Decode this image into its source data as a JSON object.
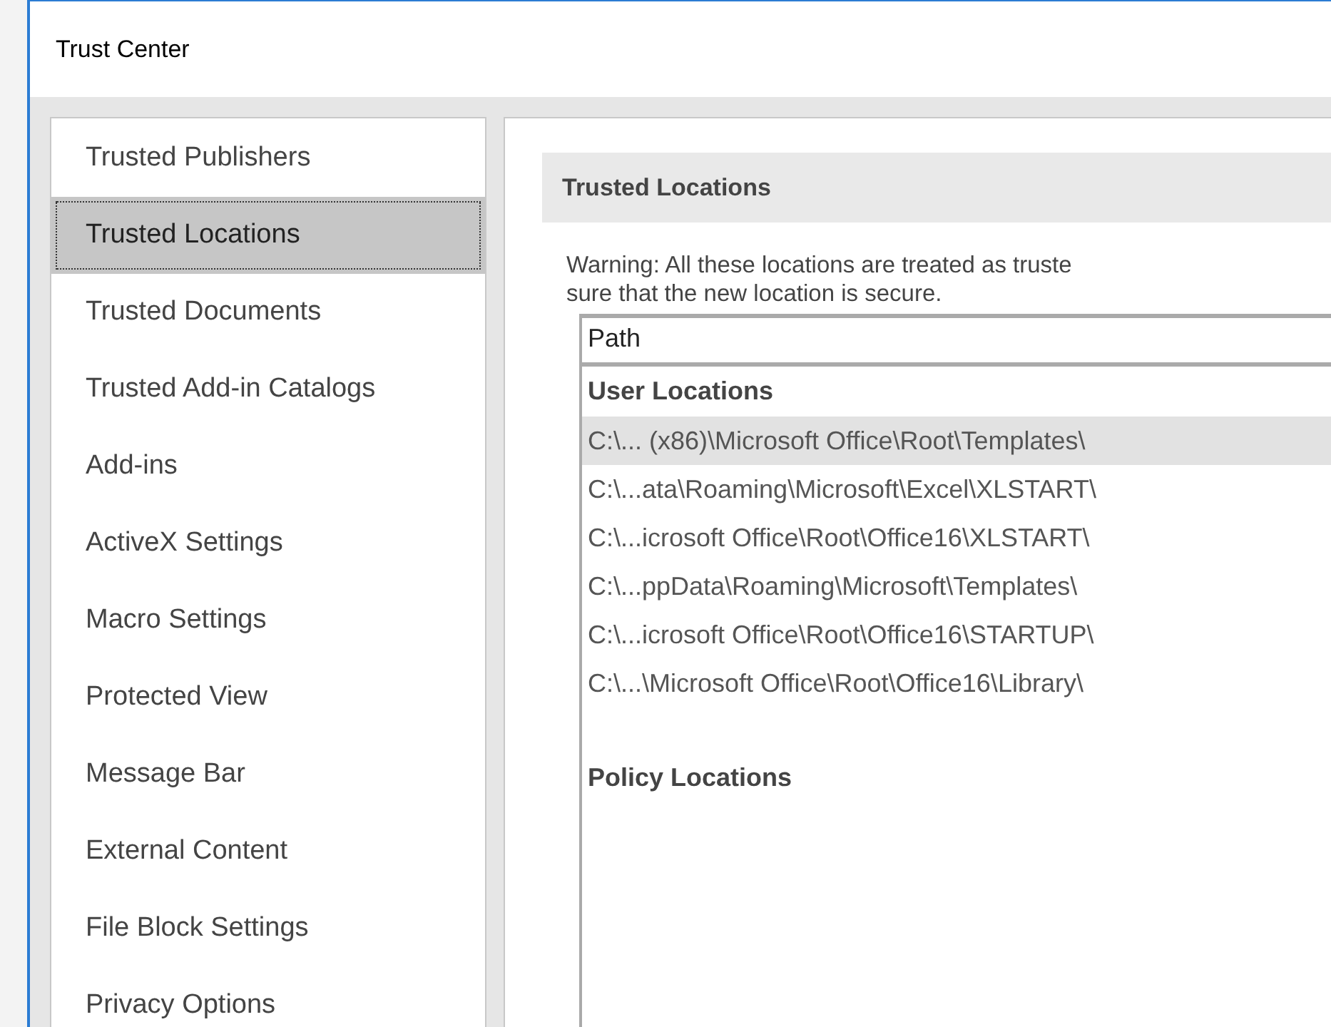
{
  "window": {
    "title": "Trust Center"
  },
  "sidebar": {
    "items": [
      {
        "label": "Trusted Publishers",
        "selected": false
      },
      {
        "label": "Trusted Locations",
        "selected": true
      },
      {
        "label": "Trusted Documents",
        "selected": false
      },
      {
        "label": "Trusted Add-in Catalogs",
        "selected": false
      },
      {
        "label": "Add-ins",
        "selected": false
      },
      {
        "label": "ActiveX Settings",
        "selected": false
      },
      {
        "label": "Macro Settings",
        "selected": false
      },
      {
        "label": "Protected View",
        "selected": false
      },
      {
        "label": "Message Bar",
        "selected": false
      },
      {
        "label": "External Content",
        "selected": false
      },
      {
        "label": "File Block Settings",
        "selected": false
      },
      {
        "label": "Privacy Options",
        "selected": false
      }
    ]
  },
  "content": {
    "section_title": "Trusted Locations",
    "warning_lines": [
      "Warning: All these locations are treated as truste",
      "sure that the new location is secure."
    ],
    "table": {
      "columns": [
        "Path"
      ],
      "rows": [
        {
          "kind": "group",
          "text": "User Locations"
        },
        {
          "kind": "path",
          "text": "C:\\... (x86)\\Microsoft Office\\Root\\Templates\\",
          "selected": true
        },
        {
          "kind": "path",
          "text": "C:\\...ata\\Roaming\\Microsoft\\Excel\\XLSTART\\",
          "selected": false
        },
        {
          "kind": "path",
          "text": "C:\\...icrosoft Office\\Root\\Office16\\XLSTART\\",
          "selected": false
        },
        {
          "kind": "path",
          "text": "C:\\...ppData\\Roaming\\Microsoft\\Templates\\",
          "selected": false
        },
        {
          "kind": "path",
          "text": "C:\\...icrosoft Office\\Root\\Office16\\STARTUP\\",
          "selected": false
        },
        {
          "kind": "path",
          "text": "C:\\...\\Microsoft Office\\Root\\Office16\\Library\\",
          "selected": false
        },
        {
          "kind": "spacer"
        },
        {
          "kind": "group",
          "text": "Policy Locations"
        }
      ]
    }
  }
}
